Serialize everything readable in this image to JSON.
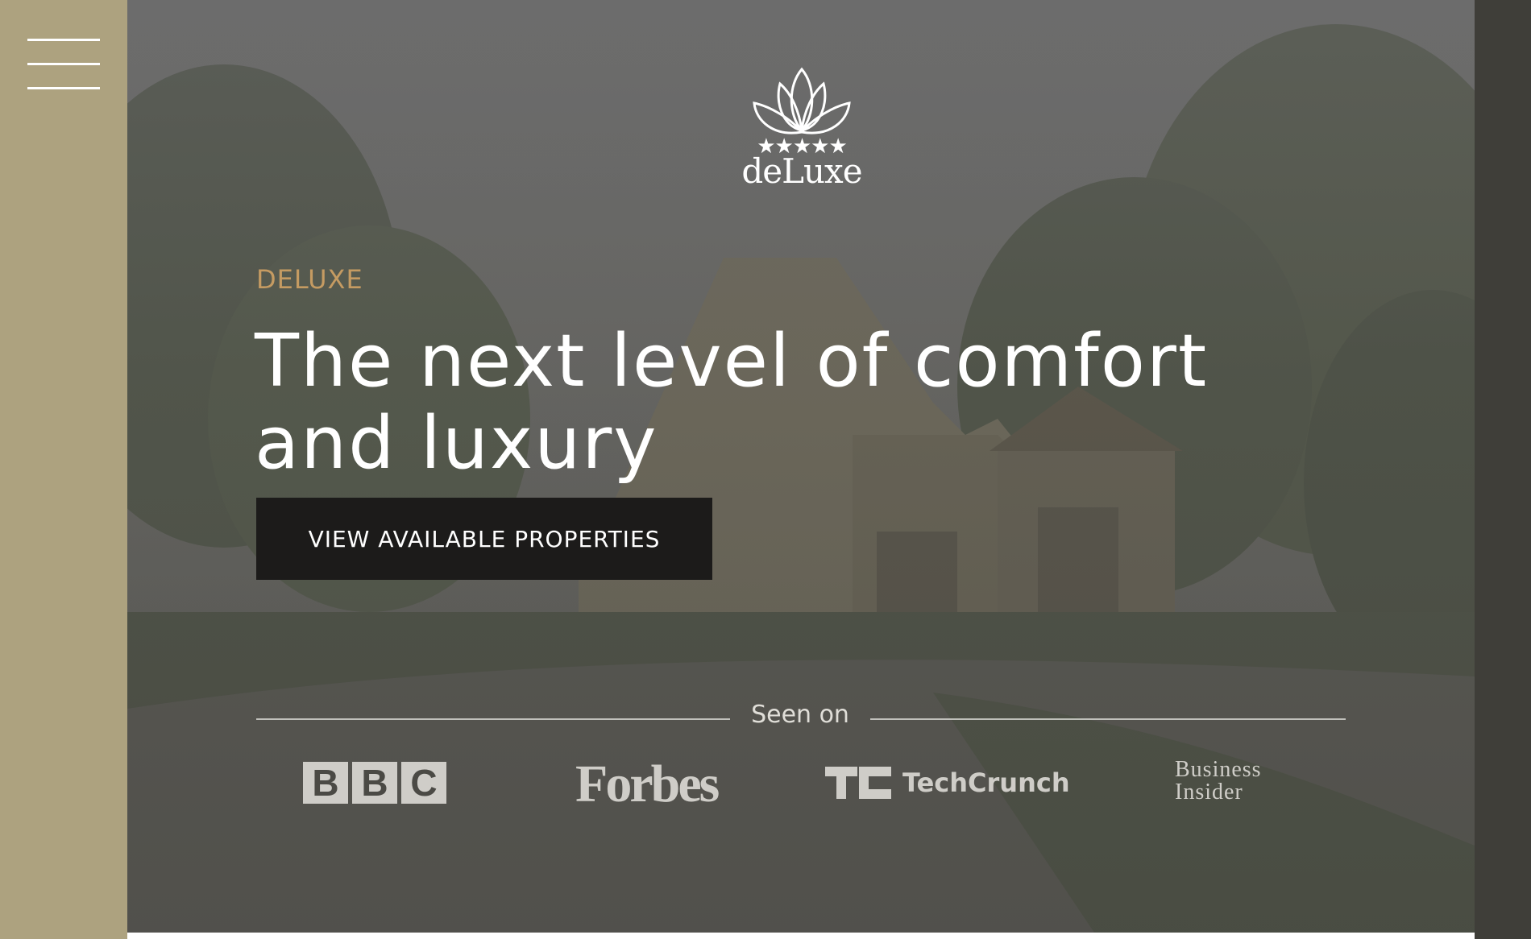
{
  "nav": {
    "menu_icon": "hamburger-menu-icon"
  },
  "logo": {
    "icon": "lotus-icon",
    "stars": "★★★★★",
    "wordmark": "deLuxe"
  },
  "hero": {
    "eyebrow": "DELUXE",
    "headline": "The next level of comfort and luxury",
    "cta_label": "VIEW AVAILABLE PROPERTIES"
  },
  "press": {
    "label": "Seen on",
    "logos": {
      "bbc": [
        "B",
        "B",
        "C"
      ],
      "forbes": "Forbes",
      "techcrunch_mark": "TC",
      "techcrunch_word": "TechCrunch",
      "business_insider_line1": "Business",
      "business_insider_line2": "Insider"
    }
  },
  "colors": {
    "sidebar": "#ada27f",
    "accent": "#c59b62",
    "cta_bg": "#1c1b1a",
    "right_strip": "#3f3e39"
  }
}
